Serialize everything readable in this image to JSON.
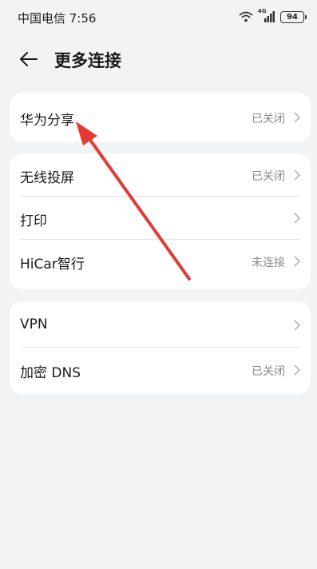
{
  "status_bar": {
    "carrier_time": "中国电信 7:56",
    "network": "4G",
    "battery": "94"
  },
  "header": {
    "back_icon": "arrow-left-icon",
    "title": "更多连接"
  },
  "groups": [
    {
      "items": [
        {
          "label": "华为分享",
          "value": "已关闭"
        }
      ]
    },
    {
      "items": [
        {
          "label": "无线投屏",
          "value": "已关闭"
        },
        {
          "label": "打印",
          "value": ""
        },
        {
          "label": "HiCar智行",
          "value": "未连接"
        }
      ]
    },
    {
      "items": [
        {
          "label": "VPN",
          "value": ""
        },
        {
          "label": "加密 DNS",
          "value": "已关闭"
        }
      ]
    }
  ],
  "colors": {
    "background": "#f1f3f5",
    "card": "#ffffff",
    "secondary_text": "#8a8a8a",
    "annotation_arrow": "#e53935"
  }
}
